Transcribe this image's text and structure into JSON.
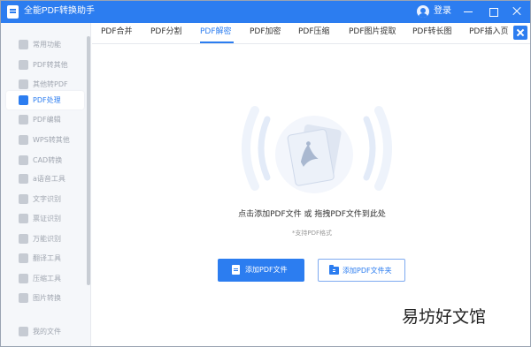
{
  "app": {
    "title": "全能PDF转换助手",
    "login_label": "登录"
  },
  "sidebar": {
    "items": [
      {
        "label": "常用功能",
        "icon": "star-icon",
        "active": false
      },
      {
        "label": "PDF转其他",
        "icon": "pdf-export-icon",
        "active": false
      },
      {
        "label": "其他转PDF",
        "icon": "pdf-import-icon",
        "active": false
      },
      {
        "label": "PDF处理",
        "icon": "pdf-process-icon",
        "active": true
      },
      {
        "label": "PDF编辑",
        "icon": "pdf-edit-icon",
        "active": false
      },
      {
        "label": "WPS转其他",
        "icon": "wps-icon",
        "active": false
      },
      {
        "label": "CAD转换",
        "icon": "cad-icon",
        "active": false
      },
      {
        "label": "a语音工具",
        "icon": "audio-icon",
        "active": false
      },
      {
        "label": "文字识别",
        "icon": "text-recognition-icon",
        "active": false
      },
      {
        "label": "票证识别",
        "icon": "ticket-icon",
        "active": false
      },
      {
        "label": "万能识别",
        "icon": "universal-recognition-icon",
        "active": false
      },
      {
        "label": "翻译工具",
        "icon": "translate-icon",
        "active": false
      },
      {
        "label": "压缩工具",
        "icon": "compress-icon",
        "active": false
      },
      {
        "label": "图片转换",
        "icon": "image-convert-icon",
        "active": false
      },
      {
        "label": "我的文件",
        "icon": "my-files-icon",
        "active": false
      }
    ]
  },
  "tabs": [
    {
      "label": "PDF合并",
      "active": false
    },
    {
      "label": "PDF分割",
      "active": false
    },
    {
      "label": "PDF解密",
      "active": true
    },
    {
      "label": "PDF加密",
      "active": false
    },
    {
      "label": "PDF压缩",
      "active": false
    },
    {
      "label": "PDF图片提取",
      "active": false
    },
    {
      "label": "PDF转长图",
      "active": false
    },
    {
      "label": "PDF插入页",
      "active": false
    }
  ],
  "main": {
    "instruction": "点击添加PDF文件 或 拖拽PDF文件到此处",
    "support_text": "*支持PDF格式",
    "add_file_label": "添加PDF文件",
    "add_folder_label": "添加PDF文件夹"
  },
  "watermark": "易坊好文馆",
  "colors": {
    "accent": "#2c7df0",
    "sidebar_bg": "#f5f7fa",
    "muted_text": "#a0a6b0"
  }
}
